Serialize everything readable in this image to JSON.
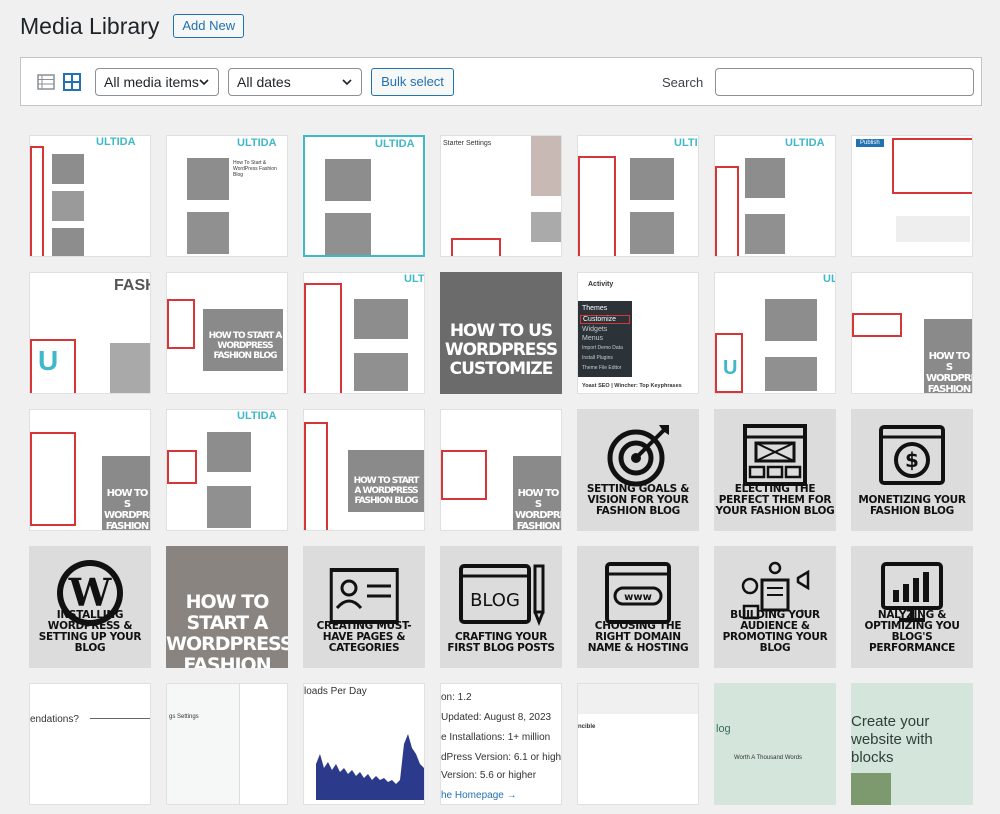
{
  "header": {
    "title": "Media Library",
    "add_new": "Add New"
  },
  "toolbar": {
    "type_filter": "All media items",
    "date_filter": "All dates",
    "bulk_select": "Bulk select",
    "search_label": "Search",
    "search_value": ""
  },
  "tiles": {
    "t1_1": {
      "brand": "ULTIDA"
    },
    "t1_2": {
      "brand": "ULTIDA",
      "text": "How To Start & WordPress Fashion Blog"
    },
    "t1_3": {
      "brand": "ULTIDA"
    },
    "t1_4": {
      "text": "Starter Settings"
    },
    "t1_5": {
      "brand": "ULTI"
    },
    "t1_6": {
      "brand": "ULTIDA"
    },
    "t1_7": {
      "text": "Publish"
    },
    "t2_1": {
      "text": "FASHI"
    },
    "t2_2": {
      "text": "HOW TO START A WORDPRESS FASHION BLOG"
    },
    "t2_3": {
      "brand": "ULT"
    },
    "t2_4": {
      "text": "HOW TO US WORDPRESS CUSTOMIZE"
    },
    "t2_5": {
      "text": "Activity",
      "menu": [
        "Themes",
        "Customize",
        "Widgets",
        "Menus",
        "Import Demo Data",
        "Install Plugins",
        "Theme File Editor"
      ],
      "foot": "Yoast SEO | Wincher: Top Keyphrases"
    },
    "t2_6": {
      "brand": "ULT"
    },
    "t2_7": {
      "text": "HOW TO S WORDPRESS FASHION BLOG"
    },
    "t3_1": {
      "text": "HOW TO S WORDPRES FASHION B"
    },
    "t3_2": {
      "brand": "ULTIDA"
    },
    "t3_3": {
      "text": "HOW TO START A WORDPRESS FASHION BLOG"
    },
    "t3_4": {
      "text": "HOW TO S WORDPRES FASHION B"
    },
    "t3_5": {
      "cap": "SETTING GOALS & VISION FOR YOUR FASHION BLOG",
      "icon": "target-icon"
    },
    "t3_6": {
      "cap": "ELECTING THE PERFECT THEM FOR YOUR FASHION BLOG",
      "icon": "layout-icon"
    },
    "t3_7": {
      "cap": "MONETIZING YOUR FASHION BLOG",
      "icon": "dollar-screen-icon"
    },
    "t4_1": {
      "cap": "INSTALLING WORDPRESS & SETTING UP YOUR BLOG",
      "icon": "wordpress-icon"
    },
    "t4_2": {
      "text": "HOW TO START A WORDPRESS FASHION BLOG"
    },
    "t4_3": {
      "cap": "CREATING MUST-HAVE PAGES & CATEGORIES",
      "icon": "id-card-icon"
    },
    "t4_4": {
      "cap": "CRAFTING YOUR FIRST BLOG POSTS",
      "icon": "blog-pencil-icon",
      "label": "BLOG"
    },
    "t4_5": {
      "cap": "CHOOSING THE RIGHT DOMAIN NAME & HOSTING",
      "icon": "www-icon",
      "label": "www"
    },
    "t4_6": {
      "cap": "BUILDING YOUR AUDIENCE & PROMOTING YOUR BLOG",
      "icon": "audience-icon"
    },
    "t4_7": {
      "cap": "NALYZING & OPTIMIZING YOU BLOG'S PERFORMANCE",
      "icon": "analytics-icon"
    },
    "t5_1": {
      "text": "endations?"
    },
    "t5_2": {
      "text": "gs Settings"
    },
    "t5_3": {
      "text": "loads Per Day"
    },
    "t5_4": {
      "lines": [
        "on: 1.2",
        "Updated: August 8, 2023",
        "e Installations: 1+ million",
        "dPress Version: 6.1 or highe",
        "Version: 5.6 or higher",
        "he Homepage →"
      ]
    },
    "t5_5": {
      "text": "ncible"
    },
    "t5_6": {
      "text": "log",
      "sub": "Worth A Thousand Words"
    },
    "t5_7": {
      "text": "Create your website with blocks"
    }
  }
}
